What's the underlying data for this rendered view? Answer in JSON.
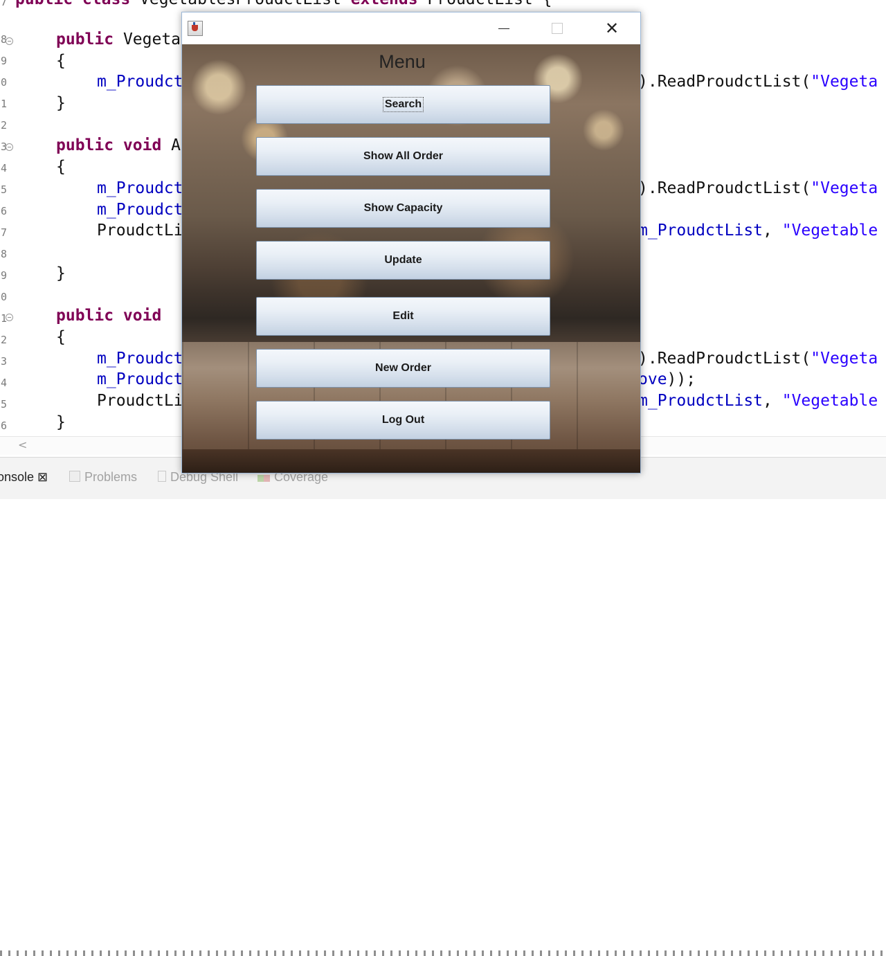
{
  "editor": {
    "line_numbers": [
      "7",
      "8",
      "9",
      "0",
      "1",
      "2",
      "3",
      "4",
      "5",
      "6",
      "7",
      "8",
      "9",
      "0",
      "1",
      "2",
      "3",
      "4",
      "5",
      "6"
    ],
    "code": {
      "class_decl": {
        "kw1": "public class",
        "name": " VegetablesProudctList ",
        "kw2": "extends",
        "rest": " ProudctList {"
      },
      "ctor_decl": {
        "kw": "public",
        "rest": " Vegeta"
      },
      "brace_open": "{",
      "brace_close": "}",
      "ctor_body": {
        "field": "m_Proudct"
      },
      "method1_decl": {
        "kw": "public void",
        "rest": " A"
      },
      "m1_l1": {
        "field": "m_Proudct"
      },
      "m1_l2": {
        "field": "m_Proudct"
      },
      "m1_l3": {
        "plain": "ProudctLi"
      },
      "method2_decl": {
        "kw": "public void",
        "rest": " "
      },
      "m2_l1": {
        "field": "m_Proudct"
      },
      "m2_l2": {
        "field": "m_Proudct"
      },
      "m2_l3": {
        "plain": "ProudctLi"
      },
      "right_read1": {
        "plain": ").ReadProudctList(",
        "str": "\"Vegeta"
      },
      "right_read2": {
        "plain": ").ReadProudctList(",
        "str": "\"Vegeta"
      },
      "right_list1": {
        "field": "m_ProudctList",
        "plain": ", ",
        "str": "\"Vegetable"
      },
      "right_read3": {
        "plain": ").ReadProudctList(",
        "str": "\"Vegeta"
      },
      "right_ove": {
        "field": "ove",
        "plain": "));"
      },
      "right_list2": {
        "field": "m_ProudctList",
        "plain": ", ",
        "str": "\"Vegetable"
      }
    },
    "scroll_arrow": "<"
  },
  "panel_tabs": [
    {
      "label": "onsole ⊠",
      "state": "active"
    },
    {
      "label": "Problems",
      "state": "inactive"
    },
    {
      "label": "Debug Shell",
      "state": "inactive"
    },
    {
      "label": "Coverage",
      "state": "inactive"
    }
  ],
  "window": {
    "title": "",
    "minimize_glyph": "",
    "close_glyph": "✕",
    "menu_title": "Menu",
    "buttons": [
      {
        "label": "Search",
        "focused": true
      },
      {
        "label": "Show All Order",
        "focused": false
      },
      {
        "label": "Show Capacity",
        "focused": false
      },
      {
        "label": "Update",
        "focused": false
      },
      {
        "label": "Edit",
        "focused": false
      },
      {
        "label": "New Order",
        "focused": false
      },
      {
        "label": "Log Out",
        "focused": false
      }
    ]
  },
  "colors": {
    "keyword": "#7f0055",
    "field": "#0000c0",
    "string": "#2a00ff",
    "button_border": "#7c93ad"
  }
}
